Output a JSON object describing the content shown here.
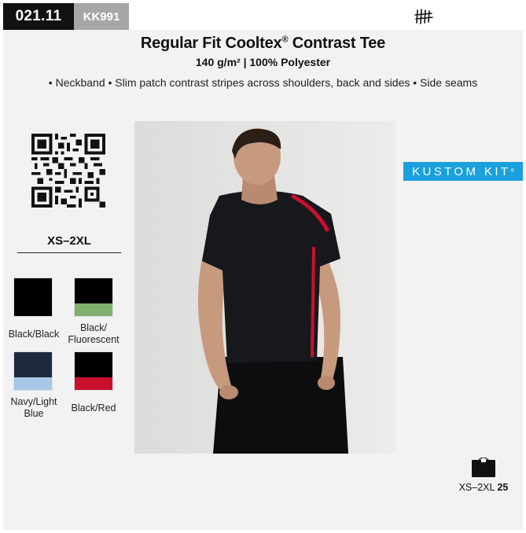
{
  "header": {
    "page_code": "021.11",
    "sku": "KK991"
  },
  "product": {
    "title": "Regular Fit Cooltex",
    "title_mark": "®",
    "title_suffix": "Contrast Tee",
    "subtitle": "140 g/m² | 100% Polyester",
    "features": "• Neckband • Slim patch contrast stripes across shoulders, back and sides • Side seams"
  },
  "sizes": {
    "range": "XS–2XL"
  },
  "colours": [
    {
      "label": "Black/Black",
      "main": "#000000",
      "accent": "#000000"
    },
    {
      "label_line1": "Black/",
      "label_line2": "Fluorescent",
      "main": "#000000",
      "accent": "#7fb06e"
    },
    {
      "label_line1": "Navy/Light",
      "label_line2": "Blue",
      "main": "#1d2a3c",
      "accent": "#a8c7e6"
    },
    {
      "label": "Black/Red",
      "main": "#000000",
      "accent": "#c8102e"
    }
  ],
  "brand": {
    "logo_text": "KUSTOM KIT",
    "logo_reg": "®",
    "logo_color": "#1aa0dc"
  },
  "packaging": {
    "range": "XS–2XL",
    "quantity": "25"
  },
  "icons": {
    "qr": "qr-code-icon",
    "brand_mark": "brand-mark-icon",
    "pack": "carton-box-icon"
  }
}
